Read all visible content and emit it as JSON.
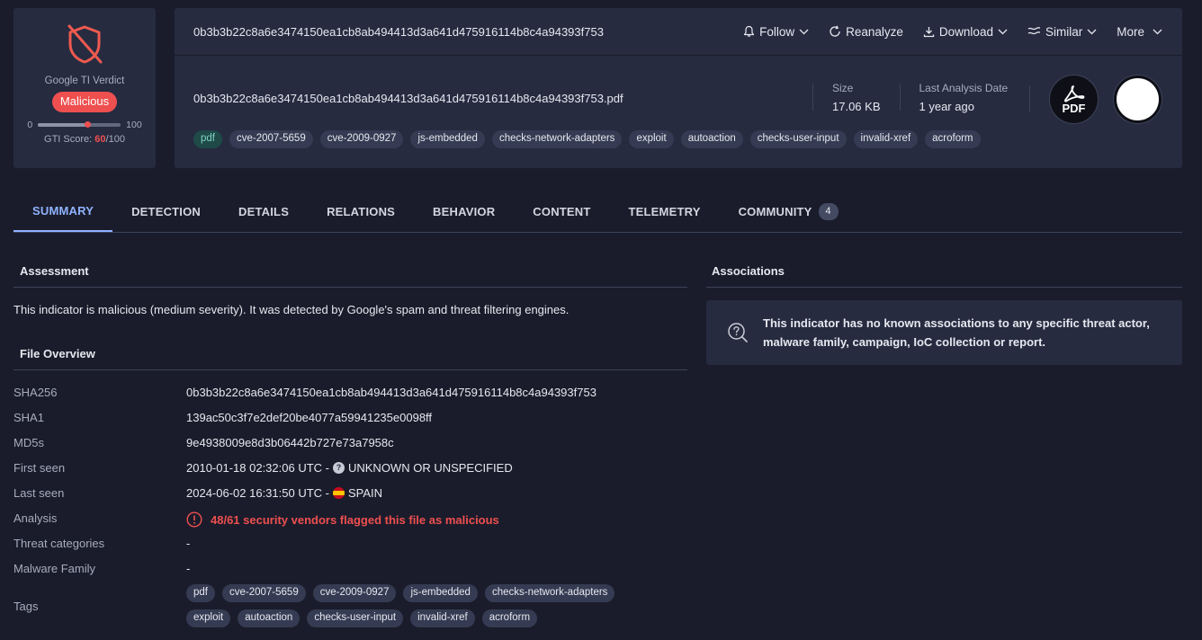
{
  "verdict": {
    "label": "Google TI Verdict",
    "badge": "Malicious",
    "slider_min": "0",
    "slider_max": "100",
    "score_prefix": "GTI Score: ",
    "score_value": "60",
    "score_suffix": "/100",
    "score_fraction": 0.6,
    "badge_color": "#ee4f4f"
  },
  "header": {
    "hash": "0b3b3b22c8a6e3474150ea1cb8ab494413d3a641d475916114b8c4a94393f753",
    "actions": {
      "follow": "Follow",
      "reanalyze": "Reanalyze",
      "download": "Download",
      "similar": "Similar",
      "more": "More"
    },
    "file_name": "0b3b3b22c8a6e3474150ea1cb8ab494413d3a641d475916114b8c4a94393f753.pdf",
    "size_label": "Size",
    "size_value": "17.06 KB",
    "last_analysis_label": "Last Analysis Date",
    "last_analysis_value": "1 year ago",
    "file_type_icon": "PDF",
    "tags": [
      "pdf",
      "cve-2007-5659",
      "cve-2009-0927",
      "js-embedded",
      "checks-network-adapters",
      "exploit",
      "autoaction",
      "checks-user-input",
      "invalid-xref",
      "acroform"
    ]
  },
  "tabs": [
    {
      "label": "SUMMARY",
      "active": true
    },
    {
      "label": "DETECTION"
    },
    {
      "label": "DETAILS"
    },
    {
      "label": "RELATIONS"
    },
    {
      "label": "BEHAVIOR"
    },
    {
      "label": "CONTENT"
    },
    {
      "label": "TELEMETRY"
    },
    {
      "label": "COMMUNITY",
      "badge": "4"
    }
  ],
  "assessment": {
    "title": "Assessment",
    "text": "This indicator is malicious (medium severity). It was detected by Google's spam and threat filtering engines."
  },
  "file_overview": {
    "title": "File Overview",
    "sha256_label": "SHA256",
    "sha256": "0b3b3b22c8a6e3474150ea1cb8ab494413d3a641d475916114b8c4a94393f753",
    "sha1_label": "SHA1",
    "sha1": "139ac50c3f7e2def20be4077a59941235e0098ff",
    "md5_label": "MD5s",
    "md5": "9e4938009e8d3b06442b727e73a7958c",
    "first_seen_label": "First seen",
    "first_seen": "2010-01-18 02:32:06 UTC - ",
    "first_seen_country": "UNKNOWN OR UNSPECIFIED",
    "last_seen_label": "Last seen",
    "last_seen": "2024-06-02 16:31:50 UTC - ",
    "last_seen_country": "SPAIN",
    "analysis_label": "Analysis",
    "analysis": "48/61 security vendors flagged this file as malicious",
    "threat_categories_label": "Threat categories",
    "threat_categories": "-",
    "malware_family_label": "Malware Family",
    "malware_family": "-",
    "tags_label": "Tags",
    "tags": [
      "pdf",
      "cve-2007-5659",
      "cve-2009-0927",
      "js-embedded",
      "checks-network-adapters",
      "exploit",
      "autoaction",
      "checks-user-input",
      "invalid-xref",
      "acroform"
    ]
  },
  "associations": {
    "title": "Associations",
    "text": "This indicator has no known associations to any specific threat actor, malware family, campaign, IoC collection or report.",
    "icon": "question-search-icon"
  }
}
